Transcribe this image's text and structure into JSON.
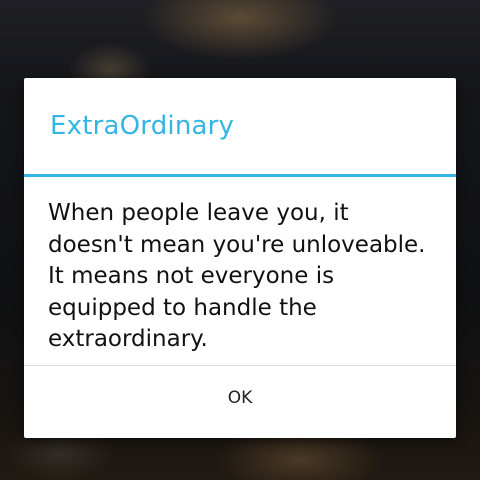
{
  "dialog": {
    "title": "ExtraOrdinary",
    "message": "When people leave you, it doesn't mean you're unloveable. It means not everyone is equipped to handle the extraordinary.",
    "ok_label": "OK"
  },
  "colors": {
    "accent": "#33b5e5",
    "dialog_background": "#ffffff",
    "message_text": "#111111"
  }
}
